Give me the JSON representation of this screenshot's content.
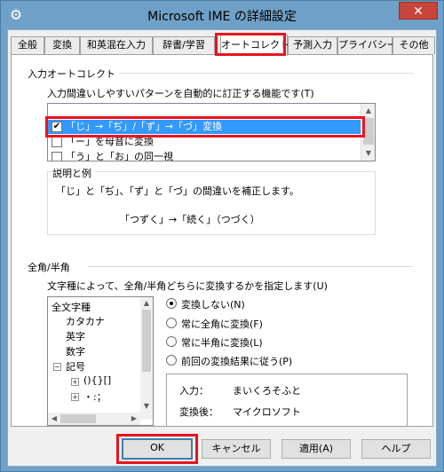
{
  "window": {
    "title": "Microsoft IME の詳細設定",
    "close_glyph": "✕",
    "icon_glyph": "⚙"
  },
  "tabs": [
    {
      "label": "全般"
    },
    {
      "label": "変換"
    },
    {
      "label": "和英混在入力"
    },
    {
      "label": "辞書/学習"
    },
    {
      "label": "オートコレクト",
      "active": true
    },
    {
      "label": "予測入力"
    },
    {
      "label": "プライバシー"
    },
    {
      "label": "その他"
    }
  ],
  "autocorrect": {
    "group_title": "入力オートコレクト",
    "description": "入力間違いしやすいパターンを自動的に訂正する機能です(T)",
    "items": [
      {
        "label": "「じ」→「ぢ」/「ず」→「づ」変換",
        "checked": true,
        "selected": true
      },
      {
        "label": "「ー」を母音に変換",
        "checked": false
      },
      {
        "label": "「う」と「お」の同一視",
        "checked": false
      }
    ],
    "example": {
      "title": "説明と例",
      "text": "「じ」と「ぢ」、「ず」と「づ」の間違いを補正します。",
      "sample": "「つずく」→「続く」（つづく）"
    }
  },
  "width": {
    "group_title": "全角/半角",
    "description": "文字種によって、全角/半角どちらに変換するかを指定します(U)",
    "tree": {
      "root": "全文字種",
      "items": [
        "カタカナ",
        "英字",
        "数字",
        "記号"
      ],
      "subitems": [
        "(){}[]",
        "・:；"
      ]
    },
    "options": [
      {
        "label": "変換しない(N)",
        "selected": true
      },
      {
        "label": "常に全角に変換(F)",
        "selected": false
      },
      {
        "label": "常に半角に変換(L)",
        "selected": false
      },
      {
        "label": "前回の変換結果に従う(P)",
        "selected": false
      }
    ],
    "preview": {
      "input_label": "入力：",
      "input_value": "まいくろそふと",
      "output_label": "変換後：",
      "output_value": "マイクロソフト"
    }
  },
  "buttons": {
    "ok": "OK",
    "cancel": "キャンセル",
    "apply": "適用(A)",
    "help": "ヘルプ"
  },
  "colors": {
    "highlight": "#e8141d",
    "selection": "#3399ff",
    "frame": "#6fa0c8"
  }
}
